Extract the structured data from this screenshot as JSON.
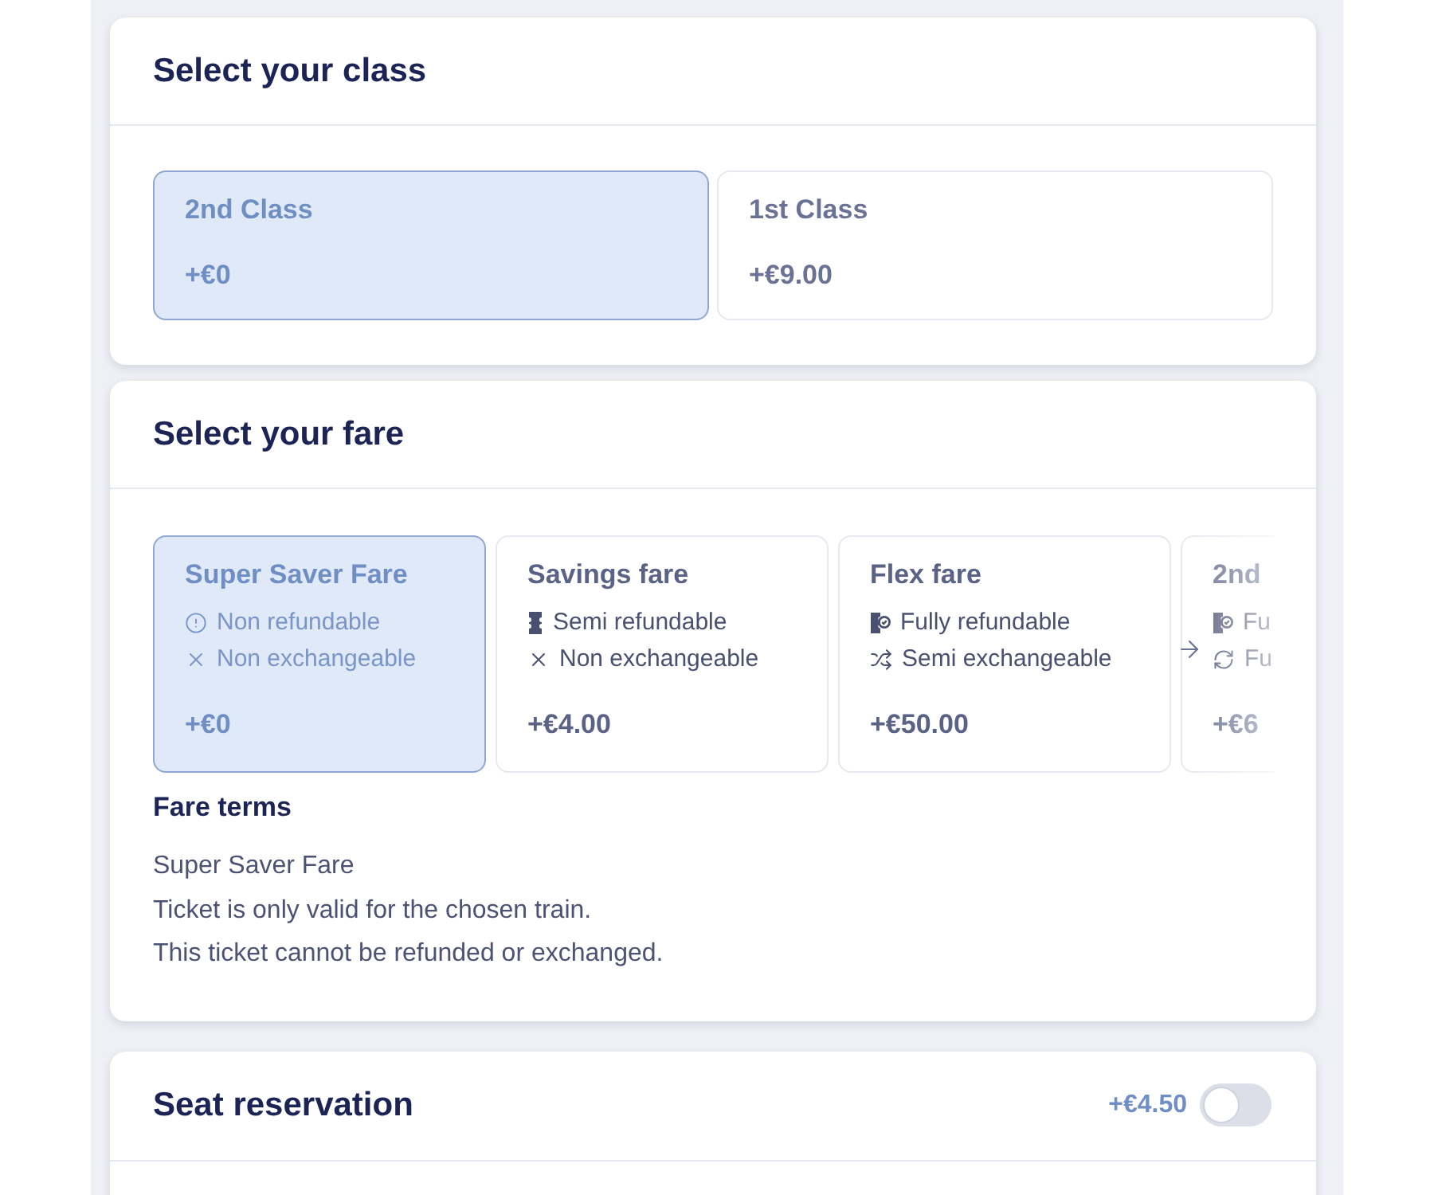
{
  "class_section": {
    "title": "Select your class",
    "options": [
      {
        "name": "2nd Class",
        "price": "+€0",
        "selected": true
      },
      {
        "name": "1st Class",
        "price": "+€9.00",
        "selected": false
      }
    ]
  },
  "fare_section": {
    "title": "Select your fare",
    "fares": [
      {
        "name": "Super Saver Fare",
        "features": [
          {
            "kind": "alert",
            "text": "Non refundable"
          },
          {
            "kind": "cross",
            "text": "Non exchangeable"
          }
        ],
        "price": "+€0",
        "selected": true
      },
      {
        "name": "Savings fare",
        "features": [
          {
            "kind": "ticket",
            "text": "Semi refundable"
          },
          {
            "kind": "cross",
            "text": "Non exchangeable"
          }
        ],
        "price": "+€4.00",
        "selected": false
      },
      {
        "name": "Flex fare",
        "features": [
          {
            "kind": "ticket-check",
            "text": "Fully refundable"
          },
          {
            "kind": "shuffle",
            "text": "Semi exchangeable"
          }
        ],
        "price": "+€50.00",
        "selected": false
      },
      {
        "name": "2nd",
        "features": [
          {
            "kind": "ticket-check",
            "text": "Fu"
          },
          {
            "kind": "refresh",
            "text": "Fu"
          }
        ],
        "price": "+€6",
        "selected": false
      }
    ],
    "terms": {
      "title": "Fare terms",
      "lines": [
        "Super Saver Fare",
        "Ticket is only valid for the chosen train.",
        "This ticket cannot be refunded or exchanged."
      ]
    }
  },
  "seat_section": {
    "title": "Seat reservation",
    "price": "+€4.50",
    "on": false
  }
}
